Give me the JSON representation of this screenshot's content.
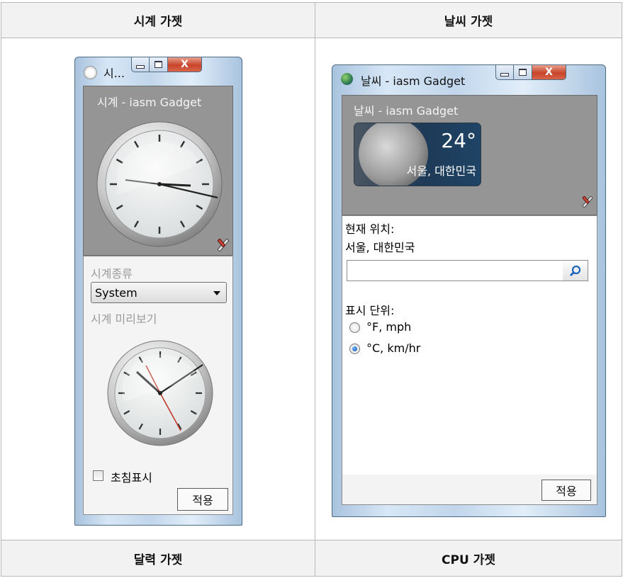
{
  "table": {
    "headers": [
      "시계 가젯",
      "날씨 가젯",
      "달력 가젯",
      "CPU 가젯"
    ]
  },
  "clock_window": {
    "title": "시...",
    "gadget_title": "시계 - iasm Gadget",
    "clock_type_label": "시계종류",
    "clock_type_value": "System",
    "preview_label": "시계 미리보기",
    "second_hand_label": "초침표시",
    "second_hand_checked": false,
    "apply_label": "적용",
    "close_glyph": "X"
  },
  "weather_window": {
    "title": "날씨 - iasm Gadget",
    "gadget_title": "날씨 - iasm Gadget",
    "temperature": "24°",
    "location_display": "서울, 대한민국",
    "current_location_label": "현재 위치:",
    "current_location_value": "서울, 대한민국",
    "search_value": "",
    "unit_label": "표시 단위:",
    "units": [
      {
        "label": "°F, mph",
        "selected": false
      },
      {
        "label": "°C, km/hr",
        "selected": true
      }
    ],
    "apply_label": "적용",
    "close_glyph": "X"
  },
  "colors": {
    "accent_red": "#c7452b",
    "window_frame": "#a9c3de",
    "gadget_gray": "#959595"
  }
}
